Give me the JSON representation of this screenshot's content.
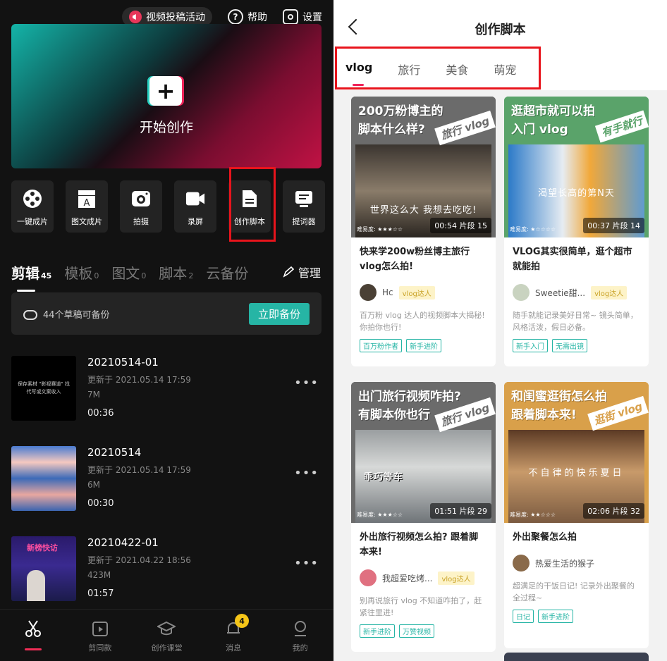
{
  "left": {
    "topbar": {
      "activity": "视频投稿活动",
      "help": "帮助",
      "settings": "设置"
    },
    "hero": {
      "label": "开始创作"
    },
    "tools": [
      {
        "label": "一键成片",
        "icon": "film-reel-icon"
      },
      {
        "label": "图文成片",
        "icon": "text-clapper-icon"
      },
      {
        "label": "拍摄",
        "icon": "camera-icon"
      },
      {
        "label": "录屏",
        "icon": "screen-record-icon"
      },
      {
        "label": "创作脚本",
        "icon": "script-doc-icon"
      },
      {
        "label": "提词器",
        "icon": "teleprompter-icon"
      }
    ],
    "tabs": [
      {
        "label": "剪辑",
        "count": "45"
      },
      {
        "label": "模板",
        "count": "0"
      },
      {
        "label": "图文",
        "count": "0"
      },
      {
        "label": "脚本",
        "count": "2"
      },
      {
        "label": "云备份",
        "count": ""
      }
    ],
    "manage": "管理",
    "backup": {
      "text": "44个草稿可备份",
      "button": "立即备份"
    },
    "drafts": [
      {
        "name": "20210514-01",
        "updated": "更新于 2021.05.14 17:59",
        "size": "7M",
        "duration": "00:36",
        "thumb_text": "保存素材 \"影视赛道\" 找代写或文案收入"
      },
      {
        "name": "20210514",
        "updated": "更新于 2021.05.14 17:59",
        "size": "6M",
        "duration": "00:30"
      },
      {
        "name": "20210422-01",
        "updated": "更新于 2021.04.22 18:56",
        "size": "423M",
        "duration": "01:57",
        "thumb_text": "新榜快访"
      }
    ],
    "nav": [
      {
        "label": "",
        "icon": "scissors-icon"
      },
      {
        "label": "剪同款",
        "icon": "template-play-icon"
      },
      {
        "label": "创作课堂",
        "icon": "graduation-cap-icon"
      },
      {
        "label": "消息",
        "icon": "bell-icon",
        "badge": "4"
      },
      {
        "label": "我的",
        "icon": "profile-icon"
      }
    ]
  },
  "right": {
    "title": "创作脚本",
    "tabs": [
      "vlog",
      "旅行",
      "美食",
      "萌宠"
    ],
    "cards": [
      {
        "headline1": "200万粉博主的",
        "headline2": "脚本什么样?",
        "stamp": "旅行 vlog",
        "subtitle": "世界这么大 我想去吃吃!",
        "difficulty": "难易度: ★★★☆☆",
        "meta": "00:54 片段 15",
        "title": "快来学200w粉丝博主旅行vlog怎么拍!",
        "author": "Hc",
        "author_tag": "vlog达人",
        "desc": "百万粉 vlog 达人的视频脚本大揭秘! 你拍你也行!",
        "tags": [
          "百万粉作者",
          "新手进阶"
        ],
        "color": "#6b6b6b"
      },
      {
        "headline1": "逛超市就可以拍",
        "headline2": "入门 vlog",
        "stamp": "有手就行",
        "subtitle": "渴望长高的第N天",
        "difficulty": "难易度: ★☆☆☆☆",
        "meta": "00:37 片段 14",
        "title": "VLOG其实很简单，逛个超市就能拍",
        "author": "Sweetie甜...",
        "author_tag": "vlog达人",
        "desc": "随手就能记录美好日常~ 镜头简单，风格活泼，假日必备。",
        "tags": [
          "新手入门",
          "无需出镜"
        ],
        "color": "#5aa36a"
      },
      {
        "headline1": "出门旅行视频咋拍?",
        "headline2": "有脚本你也行",
        "stamp": "旅行 vlog",
        "subtitle": "乖巧等车",
        "difficulty": "难易度: ★★★☆☆",
        "meta": "01:51 片段 29",
        "title": "外出旅行视频怎么拍? 跟着脚本来!",
        "author": "我超爱吃烤...",
        "author_tag": "vlog达人",
        "desc": "别再说旅行 vlog 不知道咋拍了，赶紧往里进!",
        "tags": [
          "新手进阶",
          "万赞视频"
        ],
        "color": "#6b6b6b"
      },
      {
        "headline1": "和闺蜜逛街怎么拍",
        "headline2": "跟着脚本来!",
        "stamp": "逛街 vlog",
        "subtitle": "不自律的快乐夏日",
        "difficulty": "难易度: ★★☆☆☆",
        "meta": "02:06 片段 32",
        "title": "外出聚餐怎么拍",
        "author": "热爱生活的猴子",
        "author_tag": "",
        "desc": "超满足的干饭日记! 记录外出聚餐的全过程~",
        "tags": [
          "日记",
          "新手进阶"
        ],
        "color": "#d9a04a"
      }
    ]
  }
}
